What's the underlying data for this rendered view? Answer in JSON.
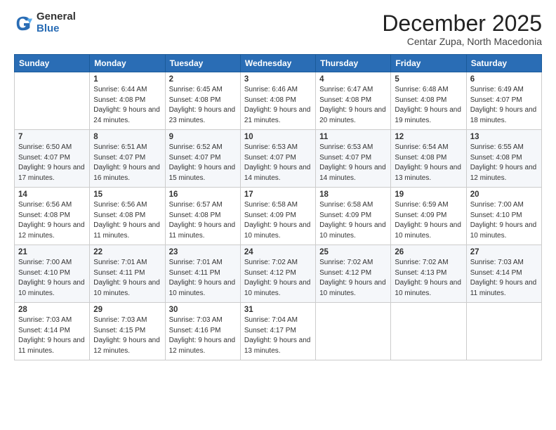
{
  "logo": {
    "general": "General",
    "blue": "Blue"
  },
  "header": {
    "month": "December 2025",
    "location": "Centar Zupa, North Macedonia"
  },
  "weekdays": [
    "Sunday",
    "Monday",
    "Tuesday",
    "Wednesday",
    "Thursday",
    "Friday",
    "Saturday"
  ],
  "weeks": [
    [
      {
        "day": "",
        "sunrise": "",
        "sunset": "",
        "daylight": ""
      },
      {
        "day": "1",
        "sunrise": "Sunrise: 6:44 AM",
        "sunset": "Sunset: 4:08 PM",
        "daylight": "Daylight: 9 hours and 24 minutes."
      },
      {
        "day": "2",
        "sunrise": "Sunrise: 6:45 AM",
        "sunset": "Sunset: 4:08 PM",
        "daylight": "Daylight: 9 hours and 23 minutes."
      },
      {
        "day": "3",
        "sunrise": "Sunrise: 6:46 AM",
        "sunset": "Sunset: 4:08 PM",
        "daylight": "Daylight: 9 hours and 21 minutes."
      },
      {
        "day": "4",
        "sunrise": "Sunrise: 6:47 AM",
        "sunset": "Sunset: 4:08 PM",
        "daylight": "Daylight: 9 hours and 20 minutes."
      },
      {
        "day": "5",
        "sunrise": "Sunrise: 6:48 AM",
        "sunset": "Sunset: 4:08 PM",
        "daylight": "Daylight: 9 hours and 19 minutes."
      },
      {
        "day": "6",
        "sunrise": "Sunrise: 6:49 AM",
        "sunset": "Sunset: 4:07 PM",
        "daylight": "Daylight: 9 hours and 18 minutes."
      }
    ],
    [
      {
        "day": "7",
        "sunrise": "Sunrise: 6:50 AM",
        "sunset": "Sunset: 4:07 PM",
        "daylight": "Daylight: 9 hours and 17 minutes."
      },
      {
        "day": "8",
        "sunrise": "Sunrise: 6:51 AM",
        "sunset": "Sunset: 4:07 PM",
        "daylight": "Daylight: 9 hours and 16 minutes."
      },
      {
        "day": "9",
        "sunrise": "Sunrise: 6:52 AM",
        "sunset": "Sunset: 4:07 PM",
        "daylight": "Daylight: 9 hours and 15 minutes."
      },
      {
        "day": "10",
        "sunrise": "Sunrise: 6:53 AM",
        "sunset": "Sunset: 4:07 PM",
        "daylight": "Daylight: 9 hours and 14 minutes."
      },
      {
        "day": "11",
        "sunrise": "Sunrise: 6:53 AM",
        "sunset": "Sunset: 4:07 PM",
        "daylight": "Daylight: 9 hours and 14 minutes."
      },
      {
        "day": "12",
        "sunrise": "Sunrise: 6:54 AM",
        "sunset": "Sunset: 4:08 PM",
        "daylight": "Daylight: 9 hours and 13 minutes."
      },
      {
        "day": "13",
        "sunrise": "Sunrise: 6:55 AM",
        "sunset": "Sunset: 4:08 PM",
        "daylight": "Daylight: 9 hours and 12 minutes."
      }
    ],
    [
      {
        "day": "14",
        "sunrise": "Sunrise: 6:56 AM",
        "sunset": "Sunset: 4:08 PM",
        "daylight": "Daylight: 9 hours and 12 minutes."
      },
      {
        "day": "15",
        "sunrise": "Sunrise: 6:56 AM",
        "sunset": "Sunset: 4:08 PM",
        "daylight": "Daylight: 9 hours and 11 minutes."
      },
      {
        "day": "16",
        "sunrise": "Sunrise: 6:57 AM",
        "sunset": "Sunset: 4:08 PM",
        "daylight": "Daylight: 9 hours and 11 minutes."
      },
      {
        "day": "17",
        "sunrise": "Sunrise: 6:58 AM",
        "sunset": "Sunset: 4:09 PM",
        "daylight": "Daylight: 9 hours and 10 minutes."
      },
      {
        "day": "18",
        "sunrise": "Sunrise: 6:58 AM",
        "sunset": "Sunset: 4:09 PM",
        "daylight": "Daylight: 9 hours and 10 minutes."
      },
      {
        "day": "19",
        "sunrise": "Sunrise: 6:59 AM",
        "sunset": "Sunset: 4:09 PM",
        "daylight": "Daylight: 9 hours and 10 minutes."
      },
      {
        "day": "20",
        "sunrise": "Sunrise: 7:00 AM",
        "sunset": "Sunset: 4:10 PM",
        "daylight": "Daylight: 9 hours and 10 minutes."
      }
    ],
    [
      {
        "day": "21",
        "sunrise": "Sunrise: 7:00 AM",
        "sunset": "Sunset: 4:10 PM",
        "daylight": "Daylight: 9 hours and 10 minutes."
      },
      {
        "day": "22",
        "sunrise": "Sunrise: 7:01 AM",
        "sunset": "Sunset: 4:11 PM",
        "daylight": "Daylight: 9 hours and 10 minutes."
      },
      {
        "day": "23",
        "sunrise": "Sunrise: 7:01 AM",
        "sunset": "Sunset: 4:11 PM",
        "daylight": "Daylight: 9 hours and 10 minutes."
      },
      {
        "day": "24",
        "sunrise": "Sunrise: 7:02 AM",
        "sunset": "Sunset: 4:12 PM",
        "daylight": "Daylight: 9 hours and 10 minutes."
      },
      {
        "day": "25",
        "sunrise": "Sunrise: 7:02 AM",
        "sunset": "Sunset: 4:12 PM",
        "daylight": "Daylight: 9 hours and 10 minutes."
      },
      {
        "day": "26",
        "sunrise": "Sunrise: 7:02 AM",
        "sunset": "Sunset: 4:13 PM",
        "daylight": "Daylight: 9 hours and 10 minutes."
      },
      {
        "day": "27",
        "sunrise": "Sunrise: 7:03 AM",
        "sunset": "Sunset: 4:14 PM",
        "daylight": "Daylight: 9 hours and 11 minutes."
      }
    ],
    [
      {
        "day": "28",
        "sunrise": "Sunrise: 7:03 AM",
        "sunset": "Sunset: 4:14 PM",
        "daylight": "Daylight: 9 hours and 11 minutes."
      },
      {
        "day": "29",
        "sunrise": "Sunrise: 7:03 AM",
        "sunset": "Sunset: 4:15 PM",
        "daylight": "Daylight: 9 hours and 12 minutes."
      },
      {
        "day": "30",
        "sunrise": "Sunrise: 7:03 AM",
        "sunset": "Sunset: 4:16 PM",
        "daylight": "Daylight: 9 hours and 12 minutes."
      },
      {
        "day": "31",
        "sunrise": "Sunrise: 7:04 AM",
        "sunset": "Sunset: 4:17 PM",
        "daylight": "Daylight: 9 hours and 13 minutes."
      },
      {
        "day": "",
        "sunrise": "",
        "sunset": "",
        "daylight": ""
      },
      {
        "day": "",
        "sunrise": "",
        "sunset": "",
        "daylight": ""
      },
      {
        "day": "",
        "sunrise": "",
        "sunset": "",
        "daylight": ""
      }
    ]
  ]
}
